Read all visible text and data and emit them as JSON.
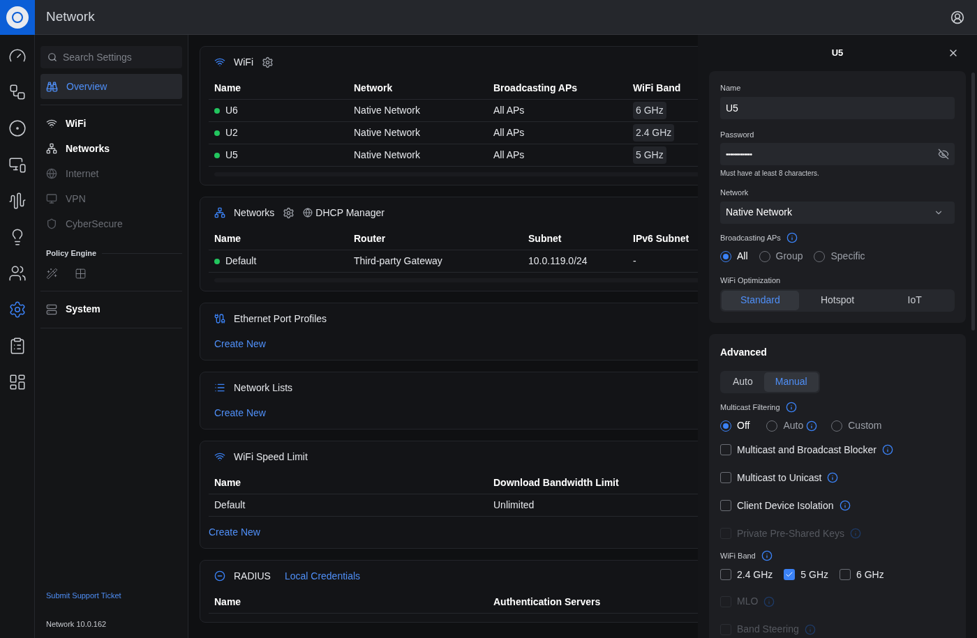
{
  "app": {
    "title": "Network"
  },
  "rail": [
    {
      "kind": "dashboard",
      "selected": false
    },
    {
      "kind": "topology",
      "selected": false
    },
    {
      "kind": "devices",
      "selected": false
    },
    {
      "kind": "clients",
      "selected": false
    },
    {
      "kind": "insights",
      "selected": false
    },
    {
      "kind": "alerts",
      "selected": false
    },
    {
      "kind": "users",
      "selected": false
    },
    {
      "kind": "settings",
      "selected": true
    },
    {
      "kind": "logs",
      "selected": false
    },
    {
      "kind": "plan",
      "selected": false
    }
  ],
  "sidebar": {
    "search": {
      "placeholder": "Search Settings"
    },
    "overview": {
      "label": "Overview",
      "selected": true
    },
    "items": [
      {
        "kind": "wifi",
        "label": "WiFi",
        "disabled": false
      },
      {
        "kind": "networks",
        "label": "Networks",
        "disabled": false
      },
      {
        "kind": "internet",
        "label": "Internet",
        "disabled": true
      },
      {
        "kind": "vpn",
        "label": "VPN",
        "disabled": true
      },
      {
        "kind": "security",
        "label": "CyberSecure",
        "disabled": true
      }
    ],
    "policy_engine": {
      "heading": "Policy Engine",
      "tools": [
        {
          "kind": "wand"
        },
        {
          "kind": "grid"
        }
      ]
    },
    "system": {
      "label": "System"
    },
    "support_link": "Submit Support Ticket",
    "version": "Network 10.0.162"
  },
  "cards": [
    {
      "kind": "wifi",
      "title": "WiFi",
      "settings": true,
      "columns": [
        "Name",
        "Network",
        "Broadcasting APs",
        "WiFi Band"
      ],
      "rows": [
        {
          "online": true,
          "cells": [
            "U6",
            "Native Network",
            "All APs",
            "6 GHz"
          ]
        },
        {
          "online": true,
          "cells": [
            "U2",
            "Native Network",
            "All APs",
            "2.4 GHz"
          ]
        },
        {
          "online": true,
          "cells": [
            "U5",
            "Native Network",
            "All APs",
            "5 GHz"
          ]
        }
      ]
    },
    {
      "kind": "networks",
      "title": "Networks",
      "settings": true,
      "extra": "DHCP Manager",
      "columns": [
        "Name",
        "Router",
        "Subnet",
        "IPv6 Subnet"
      ],
      "rows": [
        {
          "online": true,
          "cells": [
            "Default",
            "Third-party Gateway",
            "10.0.119.0/24",
            "-"
          ]
        }
      ]
    },
    {
      "kind": "ethernet",
      "title": "Ethernet Port Profiles",
      "settings": false,
      "action": "Create New"
    },
    {
      "kind": "lists",
      "title": "Network Lists",
      "settings": false,
      "action": "Create New"
    },
    {
      "kind": "speed",
      "title": "WiFi Speed Limit",
      "settings": false,
      "columns": [
        "Name",
        "Download Bandwidth Limit"
      ],
      "rows": [
        {
          "cells": [
            "Default",
            "Unlimited"
          ]
        }
      ],
      "action": "Create New"
    },
    {
      "kind": "radius",
      "title": "RADIUS",
      "settings": false,
      "link": "Local Credentials",
      "columns": [
        "Name",
        "Authentication Servers"
      ]
    }
  ],
  "panel": {
    "title": "U5",
    "name": {
      "label": "Name",
      "value": "U5"
    },
    "password": {
      "label": "Password",
      "value": "•••••••••••••",
      "hint": "Must have at least 8 characters."
    },
    "network": {
      "label": "Network",
      "value": "Native Network"
    },
    "broadcasting": {
      "label": "Broadcasting APs",
      "info": true,
      "options": [
        {
          "label": "All",
          "selected": true
        },
        {
          "label": "Group",
          "selected": false
        },
        {
          "label": "Specific",
          "selected": false
        }
      ]
    },
    "optimization": {
      "label": "WiFi Optimization",
      "options": [
        {
          "label": "Standard",
          "selected": true
        },
        {
          "label": "Hotspot",
          "selected": false
        },
        {
          "label": "IoT",
          "selected": false
        }
      ]
    },
    "advanced": {
      "title": "Advanced",
      "modes": [
        {
          "label": "Auto",
          "selected": false
        },
        {
          "label": "Manual",
          "selected": true
        }
      ],
      "multicast_filtering": {
        "label": "Multicast Filtering",
        "info": true,
        "options": [
          {
            "label": "Off",
            "selected": true
          },
          {
            "label": "Auto",
            "selected": false,
            "info": true
          },
          {
            "label": "Custom",
            "selected": false
          }
        ]
      },
      "toggles": [
        {
          "label": "Multicast and Broadcast Blocker",
          "checked": false,
          "disabled": false,
          "info": true
        },
        {
          "label": "Multicast to Unicast",
          "checked": false,
          "disabled": false,
          "info": true
        },
        {
          "label": "Client Device Isolation",
          "checked": false,
          "disabled": false,
          "info": true
        },
        {
          "label": "Private Pre-Shared Keys",
          "checked": false,
          "disabled": true,
          "info": true
        }
      ],
      "wifi_band": {
        "label": "WiFi Band",
        "info": true,
        "options": [
          {
            "label": "2.4 GHz",
            "checked": false
          },
          {
            "label": "5 GHz",
            "checked": true
          },
          {
            "label": "6 GHz",
            "checked": false
          }
        ]
      },
      "more_toggles": [
        {
          "label": "MLO",
          "checked": false,
          "disabled": true,
          "info": true
        },
        {
          "label": "Band Steering",
          "checked": false,
          "disabled": true,
          "info": true
        }
      ]
    }
  }
}
